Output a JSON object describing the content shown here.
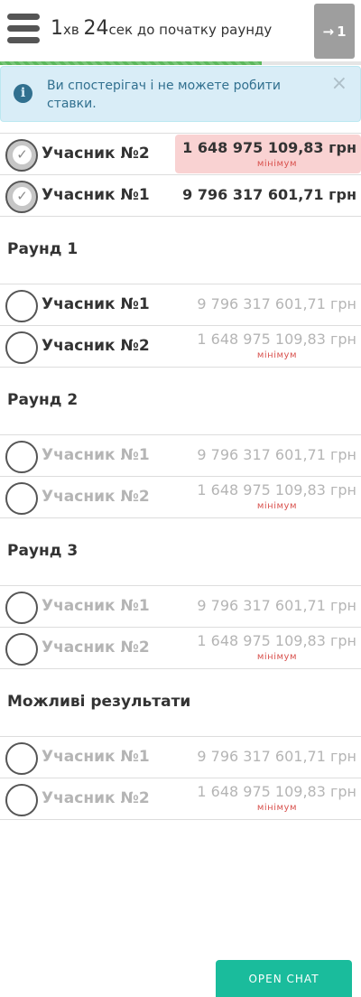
{
  "header": {
    "timer_minutes": "1",
    "timer_minutes_unit": "хв",
    "timer_seconds": "24",
    "timer_seconds_unit": "сек",
    "timer_suffix": "до початку раунду",
    "next_button_arrow": "→",
    "next_button_count": "1",
    "progress_fraction": 0.725,
    "accent_color": "#5cb85c"
  },
  "alert": {
    "text": "Ви спостерігач і не можете робити ставки.",
    "close_label": "×",
    "info_glyph": "i"
  },
  "current_picks": [
    {
      "participant": "Учасник №2",
      "amount": "1 648 975 109,83 грн",
      "note": "мінімум",
      "selected": true,
      "highlighted": true
    },
    {
      "participant": "Учасник №1",
      "amount": "9 796 317 601,71 грн",
      "note": "",
      "selected": true,
      "highlighted": false
    }
  ],
  "sections": [
    {
      "title": "Раунд 1",
      "rows": [
        {
          "participant": "Учасник №1",
          "amount": "9 796 317 601,71 грн",
          "note": "",
          "dimmed": false
        },
        {
          "participant": "Учасник №2",
          "amount": "1 648 975 109,83 грн",
          "note": "мінімум",
          "dimmed": false
        }
      ]
    },
    {
      "title": "Раунд 2",
      "rows": [
        {
          "participant": "Учасник №1",
          "amount": "9 796 317 601,71 грн",
          "note": "",
          "dimmed": true
        },
        {
          "participant": "Учасник №2",
          "amount": "1 648 975 109,83 грн",
          "note": "мінімум",
          "dimmed": true
        }
      ]
    },
    {
      "title": "Раунд 3",
      "rows": [
        {
          "participant": "Учасник №1",
          "amount": "9 796 317 601,71 грн",
          "note": "",
          "dimmed": true
        },
        {
          "participant": "Учасник №2",
          "amount": "1 648 975 109,83 грн",
          "note": "мінімум",
          "dimmed": true
        }
      ]
    },
    {
      "title": "Можливі результати",
      "rows": [
        {
          "participant": "Учасник №1",
          "amount": "9 796 317 601,71 грн",
          "note": "",
          "dimmed": true
        },
        {
          "participant": "Учасник №2",
          "amount": "1 648 975 109,83 грн",
          "note": "мінімум",
          "dimmed": true
        }
      ]
    }
  ],
  "chat_button_label": "OPEN CHAT"
}
